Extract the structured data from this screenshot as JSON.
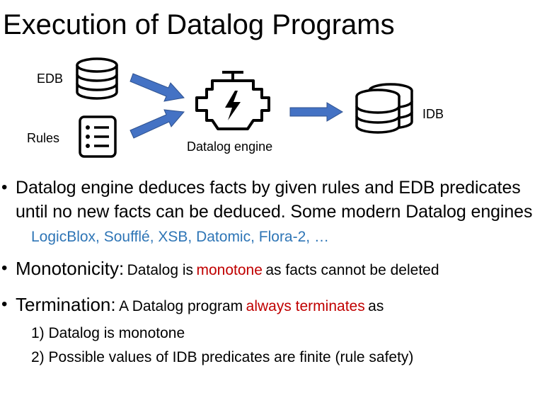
{
  "title": "Execution of Datalog Programs",
  "diagram": {
    "edb_label": "EDB",
    "rules_label": "Rules",
    "engine_label": "Datalog engine",
    "idb_label": "IDB",
    "icons": [
      "database-icon",
      "rules-list-icon",
      "engine-icon",
      "database-stack-icon"
    ],
    "arrow_color": "#4472C4"
  },
  "bullets": {
    "b1_text": "Datalog engine deduces facts by given rules and EDB predicates until no new facts can be deduced. Some modern Datalog engines",
    "b1_examples": "LogicBlox, Soufflé, XSB, Datomic, Flora-2, …",
    "b2_head": "Monotonicity:",
    "b2_pre": "Datalog is",
    "b2_highlight": "monotone",
    "b2_post": "as facts cannot be deleted",
    "b3_head": "Termination:",
    "b3_pre": "A Datalog program",
    "b3_highlight": "always terminates",
    "b3_post": "as",
    "b3_items": [
      "1) Datalog is monotone",
      "2) Possible values of IDB predicates are finite (rule safety)"
    ]
  },
  "colors": {
    "highlight_red": "#C00000",
    "example_blue": "#2E75B6"
  }
}
